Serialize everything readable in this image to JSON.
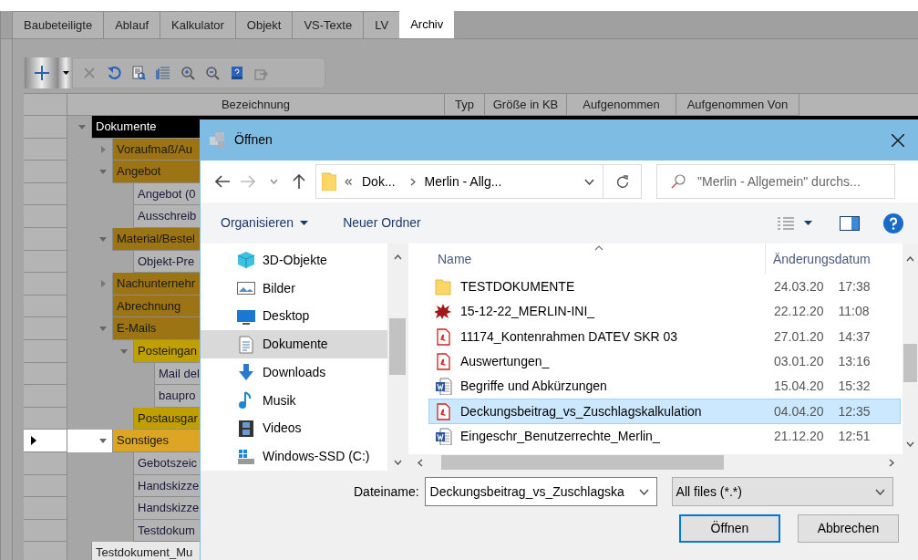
{
  "tabs": [
    {
      "label": "Baubeteiligte",
      "selected": false
    },
    {
      "label": "Ablauf",
      "selected": false
    },
    {
      "label": "Kalkulator",
      "selected": false
    },
    {
      "label": "Objekt",
      "selected": false
    },
    {
      "label": "VS-Texte",
      "selected": false
    },
    {
      "label": "LV",
      "selected": false
    },
    {
      "label": "Archiv",
      "selected": true
    }
  ],
  "toolbar": [
    {
      "kind": "add"
    },
    {
      "kind": "delete"
    },
    {
      "kind": "refresh"
    },
    {
      "kind": "preview"
    },
    {
      "kind": "list"
    },
    {
      "kind": "zoom-in"
    },
    {
      "kind": "zoom-out"
    },
    {
      "kind": "help"
    },
    {
      "kind": "export"
    }
  ],
  "grid": {
    "columns": [
      "Bezeichnung",
      "Typ",
      "Größe in KB",
      "Aufgenommen",
      "Aufgenommen Von"
    ],
    "tree": [
      {
        "label": "Dokumente",
        "color": "#000000",
        "expanded": true,
        "current": false,
        "children": [
          {
            "label": "Voraufmaß/Au",
            "color": "#9c7414",
            "expanded": false,
            "current": false
          },
          {
            "label": "Angebot",
            "color": "#9c7414",
            "expanded": true,
            "current": false,
            "children": [
              {
                "label": "Angebot (0",
                "current": false
              },
              {
                "label": "Ausschreib",
                "current": false
              }
            ]
          },
          {
            "label": "Material/Bestel",
            "color": "#9c7414",
            "expanded": true,
            "current": false,
            "children": [
              {
                "label": "Objekt-Pre",
                "current": false
              }
            ]
          },
          {
            "label": "Nachunternehr",
            "color": "#9c7414",
            "expanded": false,
            "current": false
          },
          {
            "label": "Abrechnung",
            "color": "#9c7414",
            "current": false
          },
          {
            "label": "E-Mails",
            "color": "#9c7414",
            "expanded": true,
            "current": false,
            "children": [
              {
                "label": "Posteingan",
                "color": "#bfa000",
                "expanded": true,
                "current": false,
                "children": [
                  {
                    "label": "Mail del",
                    "current": false
                  },
                  {
                    "label": "baupro",
                    "current": false
                  }
                ]
              },
              {
                "label": "Postausgar",
                "color": "#bfa000",
                "current": false
              }
            ]
          },
          {
            "label": "Sonstiges",
            "color": "#dca524",
            "expanded": true,
            "current": true,
            "children": [
              {
                "label": "Gebotszeic",
                "current": false
              },
              {
                "label": "Handskizze",
                "current": false
              },
              {
                "label": "Handskizze",
                "current": false
              },
              {
                "label": "Testdokum",
                "current": false
              }
            ]
          }
        ]
      },
      {
        "label": "Testdokument_Mu",
        "color": "#e8e8e8",
        "current": false
      }
    ]
  },
  "dialog": {
    "title": "Öffnen",
    "path": [
      "Dok...",
      "Merlin - Allg..."
    ],
    "search": {
      "placeholder": "\"Merlin - Allgemein\" durchs..."
    },
    "commands": [
      "Organisieren",
      "Neuer Ordner"
    ],
    "nav": [
      {
        "kind": "objects",
        "label": "3D-Objekte",
        "selected": false
      },
      {
        "kind": "pictures",
        "label": "Bilder",
        "selected": false
      },
      {
        "kind": "desktop",
        "label": "Desktop",
        "selected": false
      },
      {
        "kind": "documents",
        "label": "Dokumente",
        "selected": true
      },
      {
        "kind": "downloads",
        "label": "Downloads",
        "selected": false
      },
      {
        "kind": "music",
        "label": "Musik",
        "selected": false
      },
      {
        "kind": "videos",
        "label": "Videos",
        "selected": false
      },
      {
        "kind": "drive",
        "label": "Windows-SSD (C:)",
        "selected": false
      }
    ],
    "columns": [
      "Name",
      "Änderungsdatum"
    ],
    "files": [
      {
        "kind": "folder",
        "name": "TESTDOKUMENTE",
        "date": "24.03.20",
        "time": "17:38",
        "selected": false
      },
      {
        "kind": "app",
        "name": "15-12-22_MERLIN-INI_",
        "date": "22.12.20",
        "time": "11:08",
        "selected": false
      },
      {
        "kind": "pdf",
        "name": "11174_Kontenrahmen DATEV SKR 03",
        "date": "27.01.20",
        "time": "14:37",
        "selected": false
      },
      {
        "kind": "pdf",
        "name": "Auswertungen_",
        "date": "03.01.20",
        "time": "13:16",
        "selected": false
      },
      {
        "kind": "word",
        "name": "Begriffe und Abkürzungen",
        "date": "15.04.20",
        "time": "15:32",
        "selected": false
      },
      {
        "kind": "pdf",
        "name": "Deckungsbeitrag_vs_Zuschlagskalkulation",
        "date": "04.04.20",
        "time": "12:35",
        "selected": true
      },
      {
        "kind": "word",
        "name": "Eingeschr_Benutzerrechte_Merlin_",
        "date": "21.12.20",
        "time": "12:51",
        "selected": false
      }
    ],
    "filename_label": "Dateiname:",
    "filename": "Deckungsbeitrag_vs_Zuschlagska",
    "filter": "All files (*.*)",
    "buttons": [
      "Öffnen",
      "Abbrechen"
    ]
  }
}
